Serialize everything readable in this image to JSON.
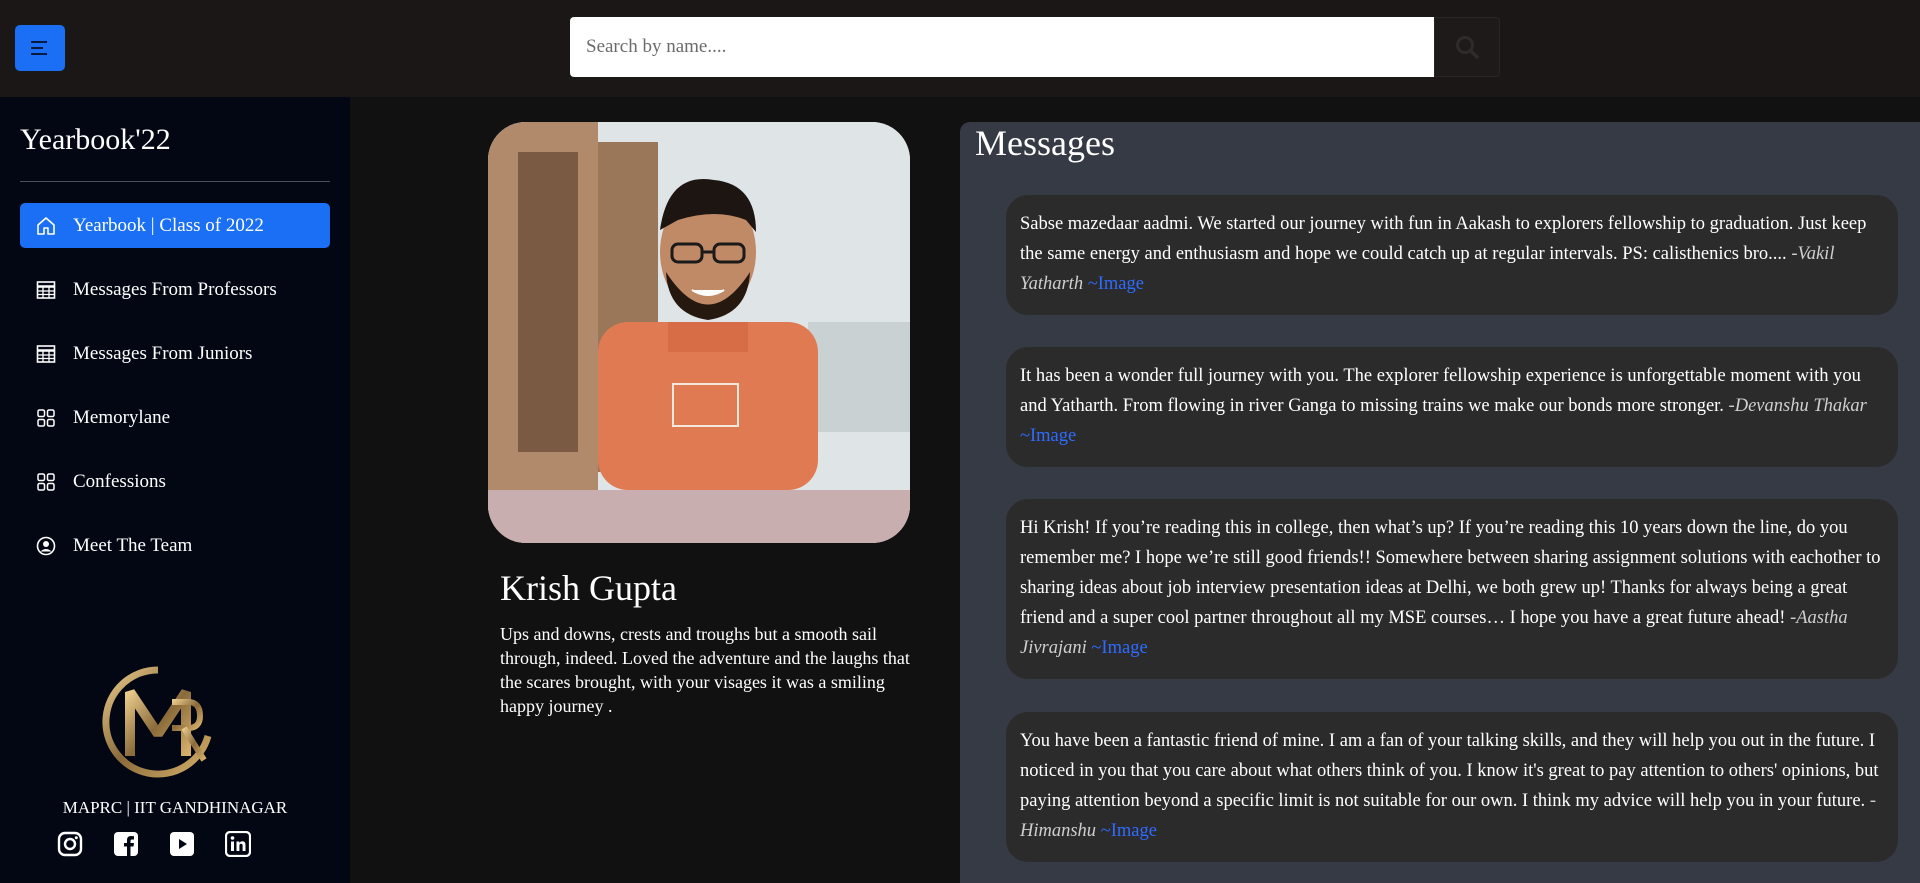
{
  "header": {
    "menu_icon": "menu-icon",
    "search": {
      "placeholder": "Search by name....",
      "value": ""
    },
    "search_icon": "search-icon"
  },
  "sidebar": {
    "brand": "Yearbook'22",
    "items": [
      {
        "label": "Yearbook | Class of 2022",
        "icon": "home-icon",
        "active": true
      },
      {
        "label": "Messages From Professors",
        "icon": "table-icon",
        "active": false
      },
      {
        "label": "Messages From Juniors",
        "icon": "table-icon",
        "active": false
      },
      {
        "label": "Memorylane",
        "icon": "grid-icon",
        "active": false
      },
      {
        "label": "Confessions",
        "icon": "grid-icon",
        "active": false
      },
      {
        "label": "Meet The Team",
        "icon": "user-circle-icon",
        "active": false
      }
    ],
    "org": "MAPRC | IIT GANDHINAGAR",
    "socials": [
      "instagram-icon",
      "facebook-icon",
      "youtube-icon",
      "linkedin-icon"
    ]
  },
  "profile": {
    "name": "Krish Gupta",
    "bio": "Ups and downs, crests and troughs but a smooth sail through, indeed. Loved the adventure and the laughs that the scares brought, with your visages it was a smiling happy journey ."
  },
  "messages": {
    "title": "Messages",
    "link_label": "~Image",
    "items": [
      {
        "text": "Sabse mazedaar aadmi. We started our journey with fun in Aakash to explorers fellowship to graduation. Just keep the same energy and enthusiasm and hope we could catch up at regular intervals. PS: calisthenics bro....",
        "author": "-Vakil Yatharth"
      },
      {
        "text": "It has been a wonder full journey with you. The explorer fellowship experience is unforgettable moment with you and Yatharth. From flowing in river Ganga to missing trains we make our bonds more stronger.",
        "author": "-Devanshu Thakar"
      },
      {
        "text": "Hi Krish! If you’re reading this in college, then what’s up? If you’re reading this 10 years down the line, do you remember me? I hope we’re still good friends!! Somewhere between sharing assignment solutions with eachother to sharing ideas about job interview presentation ideas at Delhi, we both grew up! Thanks for always being a great friend and a super cool partner throughout all my MSE courses… I hope you have a great future ahead!",
        "author": "-Aastha Jivrajani"
      },
      {
        "text": "You have been a fantastic friend of mine. I am a fan of your talking skills, and they will help you out in the future. I noticed in you that you care about what others think of you. I know it's great to pay attention to others' opinions, but paying attention beyond a specific limit is not suitable for our own. I think my advice will help you in your future.",
        "author": "-Himanshu"
      }
    ]
  }
}
